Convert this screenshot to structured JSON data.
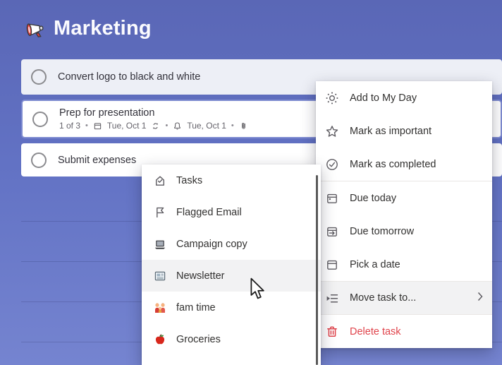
{
  "header": {
    "title": "Marketing",
    "icon": "megaphone"
  },
  "tasks": [
    {
      "title": "Convert logo to black and white"
    },
    {
      "title": "Prep for presentation",
      "steps": "1 of 3",
      "separator": "•",
      "due_date": "Tue, Oct 1",
      "reminder_date": "Tue, Oct 1",
      "has_recurrence": true,
      "has_attachment": true
    },
    {
      "title": "Submit expenses"
    }
  ],
  "context_menu": {
    "items": [
      {
        "label": "Add to My Day",
        "icon": "sun-icon"
      },
      {
        "label": "Mark as important",
        "icon": "star-icon"
      },
      {
        "label": "Mark as completed",
        "icon": "check-circle-icon"
      },
      {
        "label": "Due today",
        "icon": "calendar-today-icon"
      },
      {
        "label": "Due tomorrow",
        "icon": "calendar-tomorrow-icon"
      },
      {
        "label": "Pick a date",
        "icon": "calendar-icon"
      },
      {
        "label": "Move task to...",
        "icon": "move-list-icon",
        "has_submenu": true,
        "hovered": true
      },
      {
        "label": "Delete task",
        "icon": "trash-icon",
        "danger": true
      }
    ]
  },
  "move_submenu": {
    "items": [
      {
        "label": "Tasks",
        "icon": "home-check-icon"
      },
      {
        "label": "Flagged Email",
        "icon": "flag-icon"
      },
      {
        "label": "Campaign copy",
        "icon": "laptop-icon"
      },
      {
        "label": "Newsletter",
        "icon": "newspaper-icon",
        "hovered": true
      },
      {
        "label": "fam time",
        "icon": "family-icon"
      },
      {
        "label": "Groceries",
        "icon": "apple-icon"
      }
    ]
  },
  "colors": {
    "background_top": "#5a67b6",
    "background_bottom": "#7584d0",
    "selected_row_border": "#7e8bd0",
    "row_alt_background": "#edeff6",
    "menu_hover": "#f2f2f3",
    "danger": "#e0434b",
    "icon_gray": "#5f5d63"
  }
}
